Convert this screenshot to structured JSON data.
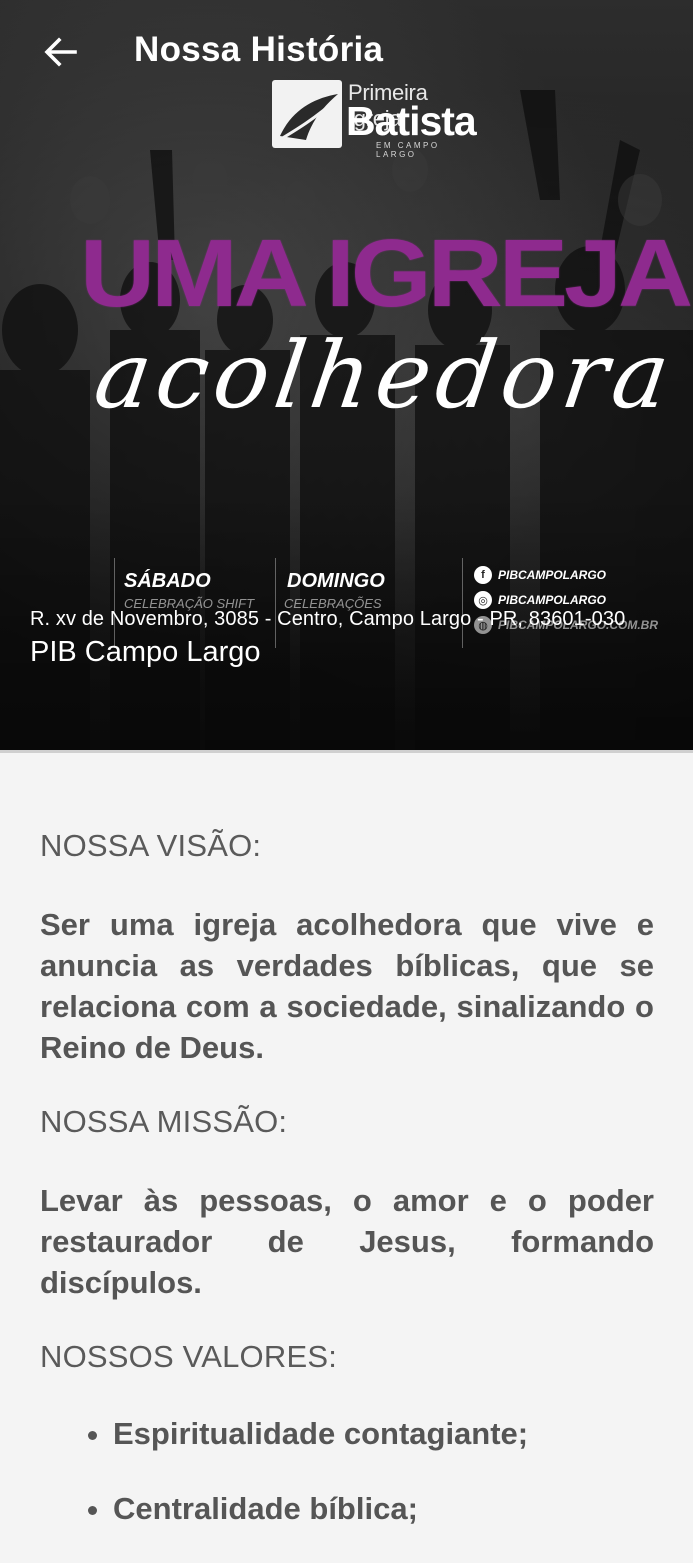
{
  "appbar": {
    "title": "Nossa História",
    "back_icon": "arrow-left-icon"
  },
  "hero": {
    "logo": {
      "line1": "Primeira Igreja",
      "line2": "Batista",
      "line3": "EM CAMPO LARGO"
    },
    "headline": "UMA IGREJA",
    "script_text": "acolhedora",
    "schedule": {
      "day1": "SÁBADO",
      "day1_sub": "CELEBRAÇÃO SHIFT",
      "day2": "DOMINGO",
      "day2_sub": "CELEBRAÇÕES",
      "social": [
        "PIBCAMPOLARGO",
        "PIBCAMPOLARGO",
        "PIBCAMPOLARGO.COM.BR"
      ]
    },
    "address": "R. xv de Novembro, 3085 - Centro, Campo Largo - PR, 83601-030",
    "church_name": "PIB Campo Largo"
  },
  "content": {
    "vision_label": "NOSSA VISÃO:",
    "vision_text": "Ser uma igreja acolhedora que vive e anuncia as verdades bíblicas, que se relaciona com a sociedade, sinalizando o Reino de Deus.",
    "mission_label": "NOSSA MISSÃO:",
    "mission_text": "Levar às pessoas, o amor e o poder restaurador de Jesus, formando discípulos.",
    "values_label": "NOSSOS VALORES:",
    "values": [
      "Espiritualidade contagiante;",
      "Centralidade bíblica;"
    ]
  },
  "colors": {
    "headline": "#8e2a8e",
    "background": "#f4f4f4",
    "text": "#555555"
  }
}
